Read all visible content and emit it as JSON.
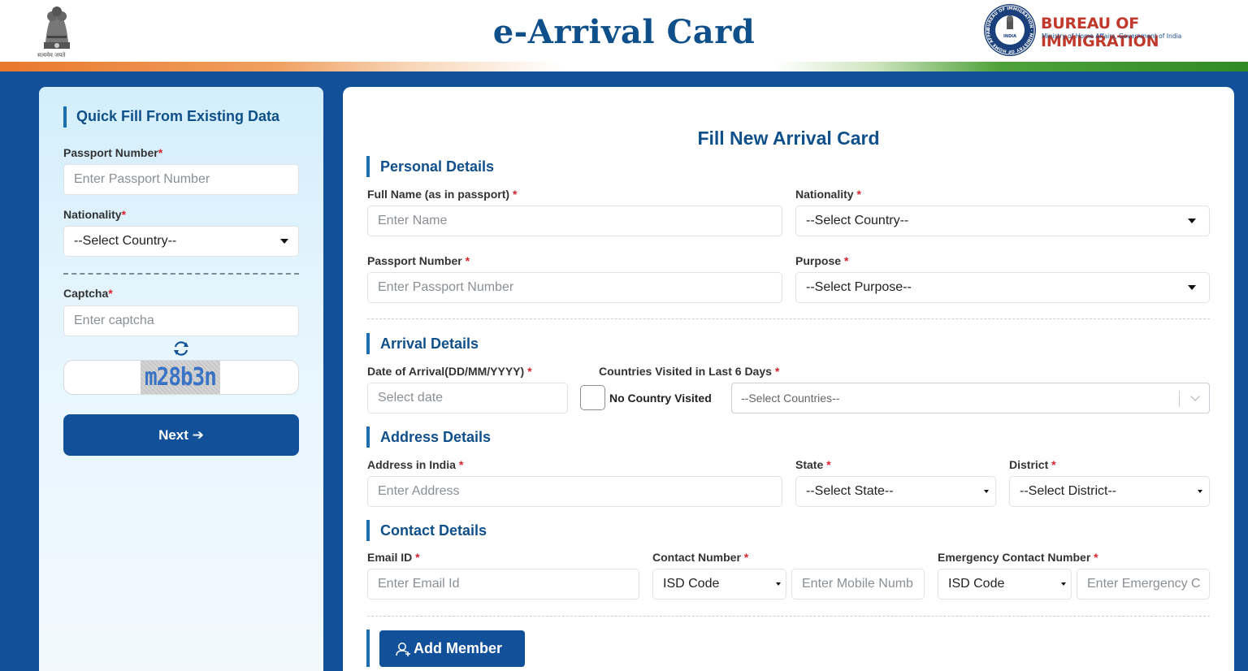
{
  "header": {
    "title": "e-Arrival Card",
    "emblem_caption": "सत्यमेव जयते",
    "org_name": "BUREAU OF IMMIGRATION",
    "org_subtitle": "Ministry of Home Affairs, Government of India",
    "seal_text": "BUREAU OF IMMIGRATION · MINISTRY OF HOME AFFAIRS",
    "seal_center": "INDIA"
  },
  "quick_fill": {
    "heading": "Quick Fill From Existing Data",
    "passport_label": "Passport Number",
    "passport_placeholder": "Enter Passport Number",
    "nationality_label": "Nationality",
    "nationality_value": "--Select Country--",
    "captcha_label": "Captcha",
    "captcha_placeholder": "Enter captcha",
    "captcha_text": "m28b3n",
    "next_label": "Next ➔"
  },
  "form": {
    "title": "Fill New Arrival Card",
    "personal": {
      "heading": "Personal Details",
      "full_name_label": "Full Name (as in passport)",
      "full_name_placeholder": "Enter Name",
      "nationality_label": "Nationality",
      "nationality_value": "--Select Country--",
      "passport_label": "Passport Number",
      "passport_placeholder": "Enter Passport Number",
      "purpose_label": "Purpose",
      "purpose_value": "--Select Purpose--"
    },
    "arrival": {
      "heading": "Arrival Details",
      "date_label": "Date of Arrival(DD/MM/YYYY)",
      "date_placeholder": "Select date",
      "countries_label": "Countries Visited in Last 6 Days",
      "no_country_label": "No Country Visited",
      "countries_value": "--Select Countries--"
    },
    "address": {
      "heading": "Address Details",
      "address_label": "Address in India",
      "address_placeholder": "Enter Address",
      "state_label": "State",
      "state_value": "--Select State--",
      "district_label": "District",
      "district_value": "--Select District--"
    },
    "contact": {
      "heading": "Contact Details",
      "email_label": "Email ID",
      "email_placeholder": "Enter Email Id",
      "contact_label": "Contact Number",
      "isd_value": "ISD Code",
      "mobile_placeholder": "Enter Mobile Numb",
      "emergency_label": "Emergency Contact Number",
      "emergency_isd_value": "ISD Code",
      "emergency_placeholder": "Enter Emergency C"
    },
    "add_member_label": "Add Member"
  },
  "required_mark": "*",
  "colors": {
    "primary": "#12509a",
    "heading": "#0f4f8a",
    "required": "#d9232d",
    "org_red": "#c0392b"
  }
}
